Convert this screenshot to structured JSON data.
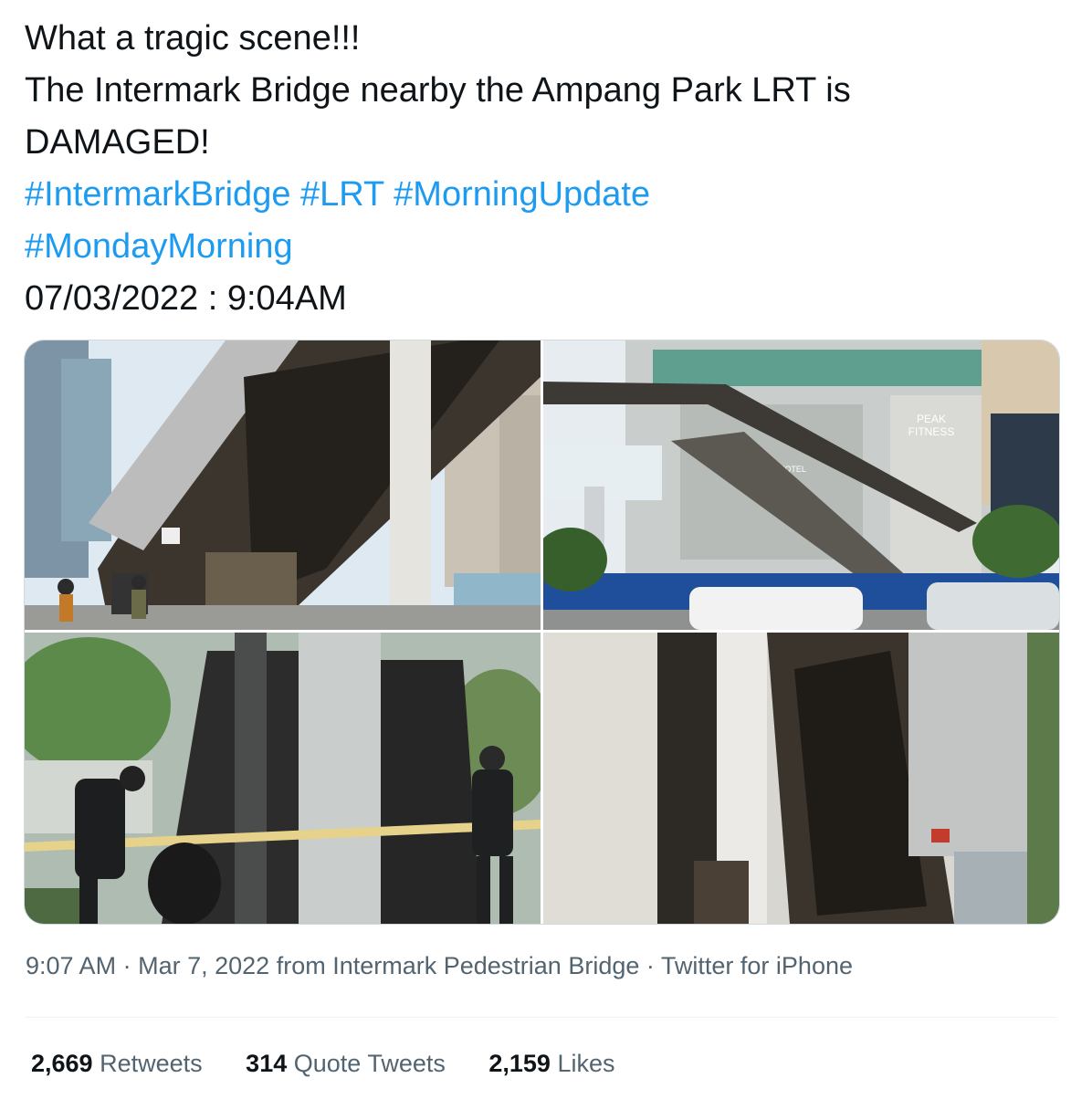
{
  "tweet": {
    "line1": "What a tragic scene!!!",
    "line2": "The Intermark Bridge nearby the Ampang Park LRT is",
    "line3": "DAMAGED!",
    "hashtags_line1": [
      "#IntermarkBridge",
      "#LRT",
      "#MorningUpdate"
    ],
    "hashtags_line2": [
      "#MondayMorning"
    ],
    "date_line": "07/03/2022 : 9:04AM"
  },
  "media": {
    "photo_count": 4,
    "signage": [
      "PEAK",
      "FITNESS",
      "TOWER HOTEL"
    ]
  },
  "meta": {
    "time": "9:07 AM",
    "sep": "·",
    "date": "Mar 7, 2022",
    "from_prefix": "from",
    "location": "Intermark Pedestrian Bridge",
    "source": "Twitter for iPhone"
  },
  "stats": {
    "retweets": {
      "count": "2,669",
      "label": "Retweets"
    },
    "quotes": {
      "count": "314",
      "label": "Quote Tweets"
    },
    "likes": {
      "count": "2,159",
      "label": "Likes"
    }
  },
  "colors": {
    "text": "#0f1419",
    "secondary": "#536471",
    "link": "#1d9bf0",
    "border": "#cfd9de"
  }
}
